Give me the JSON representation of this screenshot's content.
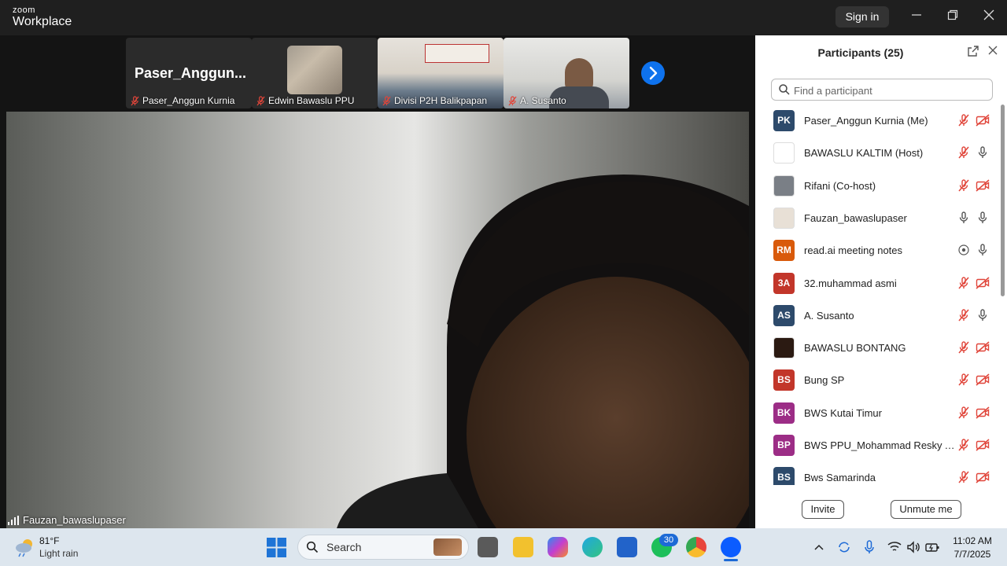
{
  "window": {
    "brand_top": "zoom",
    "brand_bottom": "Workplace",
    "sign_in": "Sign in"
  },
  "gallery": {
    "self_name_big": "Paser_Anggun...",
    "tiles": [
      {
        "name": "Paser_Anggun Kurnia"
      },
      {
        "name": "Edwin Bawaslu PPU"
      },
      {
        "name": "Divisi P2H Balikpapan"
      },
      {
        "name": "A. Susanto"
      }
    ]
  },
  "main_video": {
    "speaker": "Fauzan_bawaslupaser"
  },
  "panel": {
    "title": "Participants (25)",
    "search_placeholder": "Find a participant",
    "participants": [
      {
        "initials": "PK",
        "name": "Paser_Anggun Kurnia (Me)",
        "color": "#2d4a6b",
        "mic": "muted",
        "video": "off"
      },
      {
        "initials": "",
        "name": "BAWASLU KALTIM (Host)",
        "color": "#ffffff",
        "mic": "muted",
        "video": "on"
      },
      {
        "initials": "",
        "name": "Rifani (Co-host)",
        "color": "#7a7f86",
        "mic": "muted",
        "video": "off"
      },
      {
        "initials": "",
        "name": "Fauzan_bawaslupaser",
        "color": "#e8e0d6",
        "mic": "on",
        "video": "on"
      },
      {
        "initials": "RM",
        "name": "read.ai meeting notes",
        "color": "#d95a0b",
        "mic": "record",
        "video": "mic"
      },
      {
        "initials": "3A",
        "name": "32.muhammad asmi",
        "color": "#c2362a",
        "mic": "muted",
        "video": "off"
      },
      {
        "initials": "AS",
        "name": "A. Susanto",
        "color": "#2d4a6b",
        "mic": "muted",
        "video": "on"
      },
      {
        "initials": "",
        "name": "BAWASLU BONTANG",
        "color": "#2b1a12",
        "mic": "muted",
        "video": "off"
      },
      {
        "initials": "BS",
        "name": "Bung SP",
        "color": "#c2362a",
        "mic": "muted",
        "video": "off"
      },
      {
        "initials": "BK",
        "name": "BWS Kutai Timur",
        "color": "#9c2d86",
        "mic": "muted",
        "video": "off"
      },
      {
        "initials": "BP",
        "name": "BWS PPU_Mohammad Resky Al...",
        "color": "#9c2d86",
        "mic": "muted",
        "video": "off"
      },
      {
        "initials": "BS",
        "name": "Bws Samarinda",
        "color": "#2d4a6b",
        "mic": "muted",
        "video": "off"
      }
    ],
    "invite": "Invite",
    "unmute": "Unmute me"
  },
  "taskbar": {
    "weather_temp": "81°F",
    "weather_desc": "Light rain",
    "search_label": "Search",
    "whatsapp_badge": "30",
    "time": "11:02 AM",
    "date": "7/7/2025"
  }
}
